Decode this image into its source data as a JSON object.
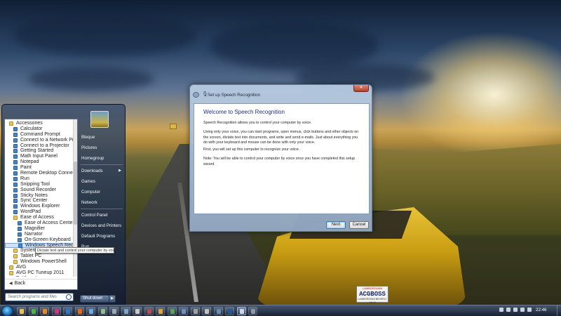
{
  "programs": {
    "items": [
      {
        "label": "Accessories",
        "kind": "folder",
        "level": 1
      },
      {
        "label": "Calculator",
        "kind": "app",
        "level": 2
      },
      {
        "label": "Command Prompt",
        "kind": "app",
        "level": 2
      },
      {
        "label": "Connect to a Network Projector",
        "kind": "app",
        "level": 2
      },
      {
        "label": "Connect to a Projector",
        "kind": "app",
        "level": 2
      },
      {
        "label": "Getting Started",
        "kind": "app",
        "level": 2
      },
      {
        "label": "Math Input Panel",
        "kind": "app",
        "level": 2
      },
      {
        "label": "Notepad",
        "kind": "app",
        "level": 2
      },
      {
        "label": "Paint",
        "kind": "app",
        "level": 2
      },
      {
        "label": "Remote Desktop Connection",
        "kind": "app",
        "level": 2
      },
      {
        "label": "Run",
        "kind": "app",
        "level": 2
      },
      {
        "label": "Snipping Tool",
        "kind": "app",
        "level": 2
      },
      {
        "label": "Sound Recorder",
        "kind": "app",
        "level": 2
      },
      {
        "label": "Sticky Notes",
        "kind": "app",
        "level": 2
      },
      {
        "label": "Sync Center",
        "kind": "app",
        "level": 2
      },
      {
        "label": "Windows Explorer",
        "kind": "app",
        "level": 2
      },
      {
        "label": "WordPad",
        "kind": "app",
        "level": 2
      },
      {
        "label": "Ease of Access",
        "kind": "folder",
        "level": 2
      },
      {
        "label": "Ease of Access Center",
        "kind": "app",
        "level": 3
      },
      {
        "label": "Magnifier",
        "kind": "app",
        "level": 3
      },
      {
        "label": "Narrator",
        "kind": "app",
        "level": 3
      },
      {
        "label": "On-Screen Keyboard",
        "kind": "app",
        "level": 3
      },
      {
        "label": "Windows Speech Recognition",
        "kind": "app",
        "level": 3,
        "selected": true
      },
      {
        "label": "System Tools",
        "kind": "folder",
        "level": 2
      },
      {
        "label": "Tablet PC",
        "kind": "folder",
        "level": 2
      },
      {
        "label": "Windows PowerShell",
        "kind": "folder",
        "level": 2
      },
      {
        "label": "AVG",
        "kind": "folder",
        "level": 1
      },
      {
        "label": "AVG PC Tuneup 2011",
        "kind": "folder",
        "level": 1
      },
      {
        "label": "Battle.net",
        "kind": "folder",
        "level": 1
      }
    ],
    "back_label": "Back"
  },
  "search": {
    "placeholder": "Search programs and files"
  },
  "right_column": {
    "items": [
      {
        "label": "Bleque",
        "arrow": false
      },
      {
        "label": "Pictures",
        "arrow": false
      },
      {
        "label": "Homegroup",
        "arrow": false
      },
      {
        "label": "Downloads",
        "arrow": true
      },
      {
        "label": "Games",
        "arrow": false
      },
      {
        "label": "Computer",
        "arrow": false
      },
      {
        "label": "Network",
        "arrow": false
      },
      {
        "label": "Control Panel",
        "arrow": false
      },
      {
        "label": "Devices and Printers",
        "arrow": false
      },
      {
        "label": "Default Programs",
        "arrow": false
      },
      {
        "label": "Run...",
        "arrow": false
      }
    ],
    "shutdown_label": "Shut down"
  },
  "tooltip": "Dictate text and control your computer by voice.",
  "dialog": {
    "title": "Set up Speech Recognition",
    "close_label": "✕",
    "heading": "Welcome to Speech Recognition",
    "paragraphs": [
      "Speech Recognition allows you to control your computer by voice.",
      "Using only your voice, you can start programs, open menus, click buttons and other objects on the screen, dictate text into documents, and write and send e-mails. Just about everything you do with your keyboard and mouse can be done with only your voice.",
      "First, you will set up this computer to recognize your voice.",
      "Note: You will be able to control your computer by voice once you have completed this setup wizard."
    ],
    "next_label": "Next",
    "cancel_label": "Cancel"
  },
  "license_plate": {
    "top": "LAMBORGHINI",
    "main": "ACGBOSS",
    "bottom": "LAMBORGHINI BEVERLY HILLS"
  },
  "taskbar": {
    "clock": "22:46",
    "pinned_icons": [
      "explorer-icon",
      "chrome-icon",
      "illustrator-icon",
      "indesign-icon",
      "photoshop-icon",
      "firefox-icon",
      "chat-icon",
      "media-icon",
      "settings-icon",
      "recycle-icon",
      "app-icon",
      "app-icon",
      "app-icon",
      "app-icon",
      "app-icon",
      "app-icon",
      "app-icon",
      "app-icon",
      "word-icon",
      "microphone-icon",
      "app-icon"
    ]
  }
}
